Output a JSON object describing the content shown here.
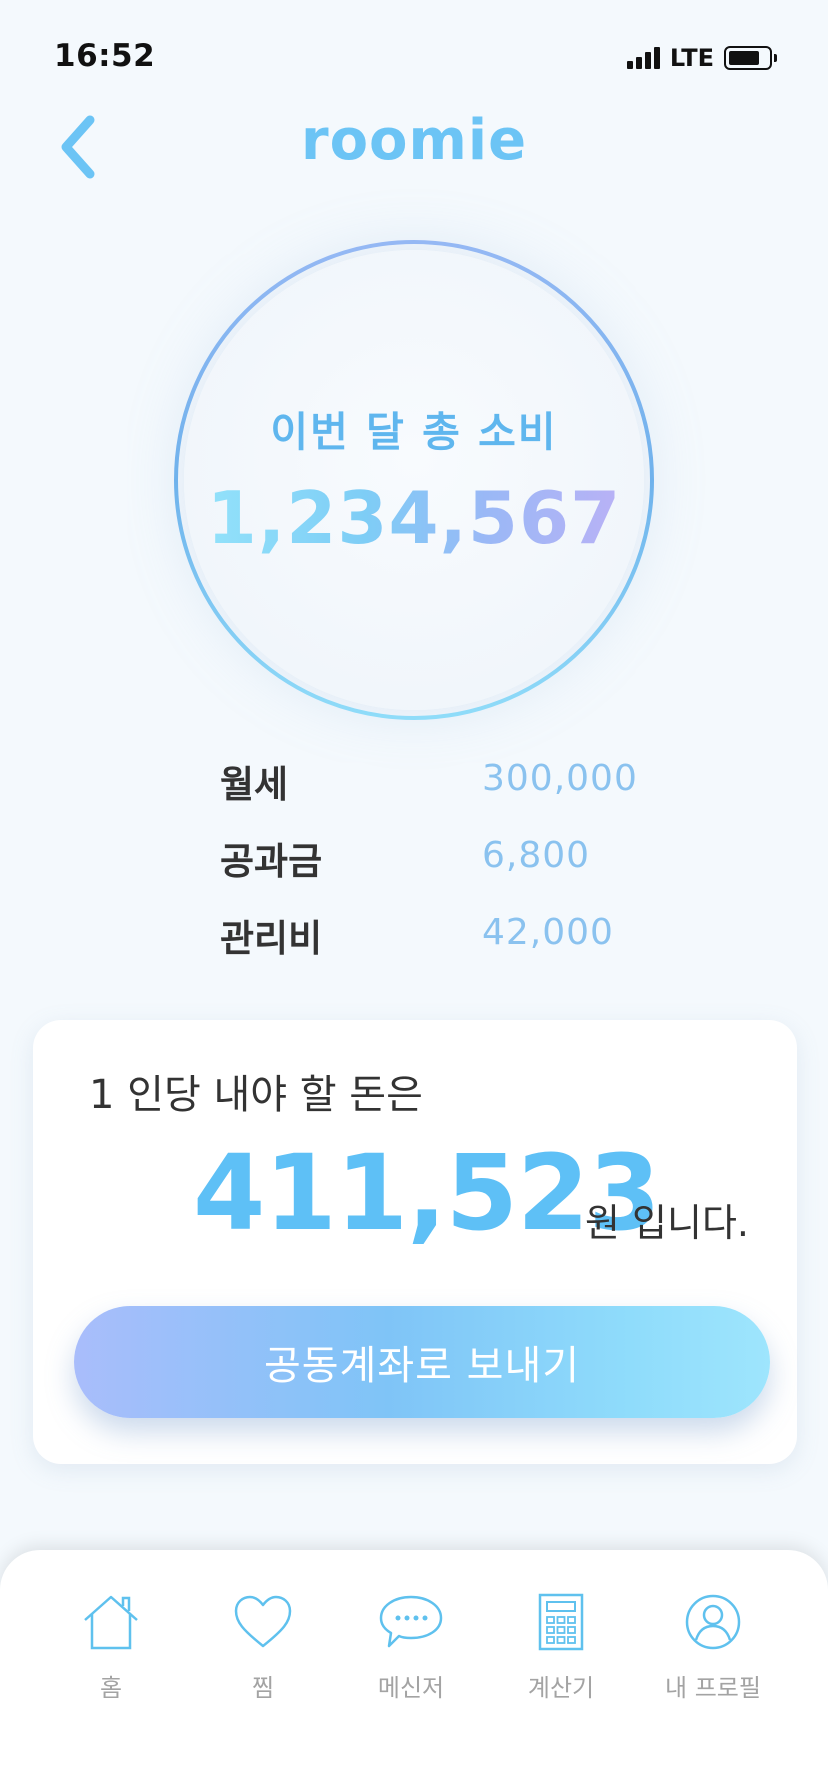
{
  "status_bar": {
    "time": "16:52",
    "network": "LTE"
  },
  "header": {
    "title": "roomie",
    "back_icon": "chevron-left-icon"
  },
  "summary": {
    "label": "이번 달 총 소비",
    "total": "1,234,567"
  },
  "costs": [
    {
      "label": "월세",
      "value": "300,000"
    },
    {
      "label": "공과금",
      "value": "6,800"
    },
    {
      "label": "관리비",
      "value": "42,000"
    }
  ],
  "card": {
    "label": "1 인당 내야 할 돈은",
    "amount": "411,523",
    "suffix": "원 입니다.",
    "button_label": "공동계좌로 보내기"
  },
  "tab_bar": {
    "items": [
      {
        "label": "홈",
        "icon": "home-icon"
      },
      {
        "label": "찜",
        "icon": "heart-icon"
      },
      {
        "label": "메신저",
        "icon": "chat-icon"
      },
      {
        "label": "계산기",
        "icon": "calculator-icon"
      },
      {
        "label": "내 프로필",
        "icon": "profile-icon"
      }
    ]
  },
  "colors": {
    "accent": "#6cc4f5",
    "value_text": "#8ac2ef",
    "background": "#f4f9fd"
  }
}
